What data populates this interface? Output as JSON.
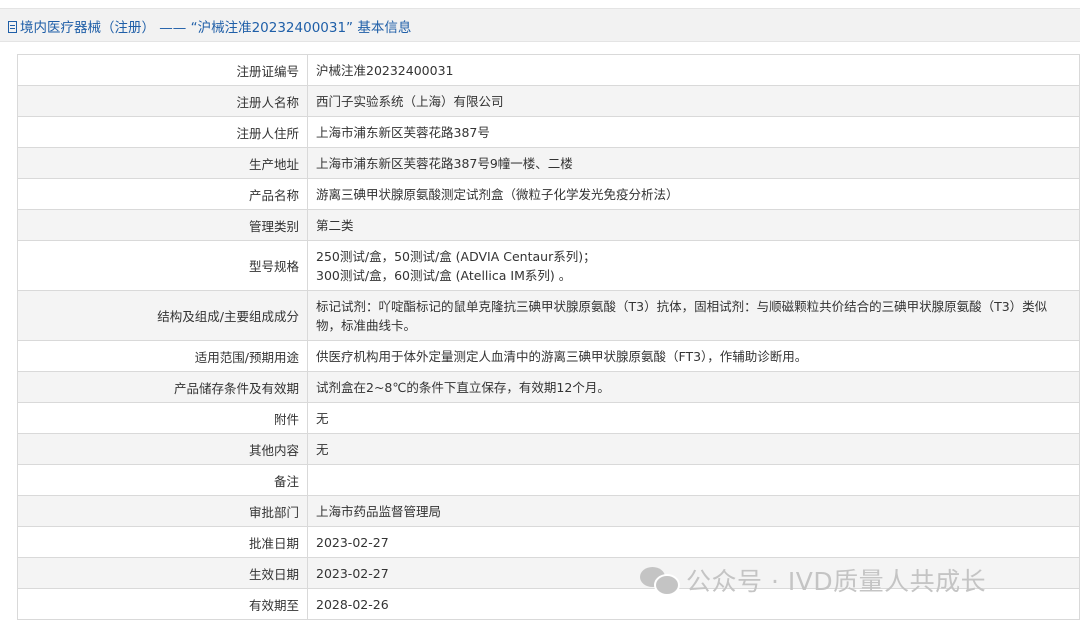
{
  "header": {
    "title": "境内医疗器械（注册） —— “沪械注准20232400031” 基本信息"
  },
  "rows": [
    {
      "label": "注册证编号",
      "lines": [
        "沪械注准20232400031"
      ]
    },
    {
      "label": "注册人名称",
      "lines": [
        "西门子实验系统（上海）有限公司"
      ]
    },
    {
      "label": "注册人住所",
      "lines": [
        "上海市浦东新区芙蓉花路387号"
      ]
    },
    {
      "label": "生产地址",
      "lines": [
        "上海市浦东新区芙蓉花路387号9幢一楼、二楼"
      ]
    },
    {
      "label": "产品名称",
      "lines": [
        "游离三碘甲状腺原氨酸测定试剂盒（微粒子化学发光免疫分析法）"
      ]
    },
    {
      "label": "管理类别",
      "lines": [
        "第二类"
      ]
    },
    {
      "label": "型号规格",
      "lines": [
        "250测试/盒，50测试/盒 (ADVIA Centaur系列)；",
        "300测试/盒，60测试/盒 (Atellica IM系列) 。"
      ]
    },
    {
      "label": "结构及组成/主要组成成分",
      "lines": [
        "标记试剂：吖啶酯标记的鼠单克隆抗三碘甲状腺原氨酸（T3）抗体，固相试剂：与顺磁颗粒共价结合的三碘甲状腺原氨酸（T3）类似",
        "物，标准曲线卡。"
      ]
    },
    {
      "label": "适用范围/预期用途",
      "lines": [
        "供医疗机构用于体外定量测定人血清中的游离三碘甲状腺原氨酸（FT3），作辅助诊断用。"
      ]
    },
    {
      "label": "产品储存条件及有效期",
      "lines": [
        "试剂盒在2~8℃的条件下直立保存，有效期12个月。"
      ]
    },
    {
      "label": "附件",
      "lines": [
        "无"
      ]
    },
    {
      "label": "其他内容",
      "lines": [
        "无"
      ]
    },
    {
      "label": "备注",
      "lines": [
        ""
      ]
    },
    {
      "label": "审批部门",
      "lines": [
        "上海市药品监督管理局"
      ]
    },
    {
      "label": "批准日期",
      "lines": [
        "2023-02-27"
      ]
    },
    {
      "label": "生效日期",
      "lines": [
        "2023-02-27"
      ]
    },
    {
      "label": "有效期至",
      "lines": [
        "2028-02-26"
      ]
    }
  ],
  "watermark": {
    "text": "公众号 · IVD质量人共成长",
    "icon": "wechat-icon"
  }
}
